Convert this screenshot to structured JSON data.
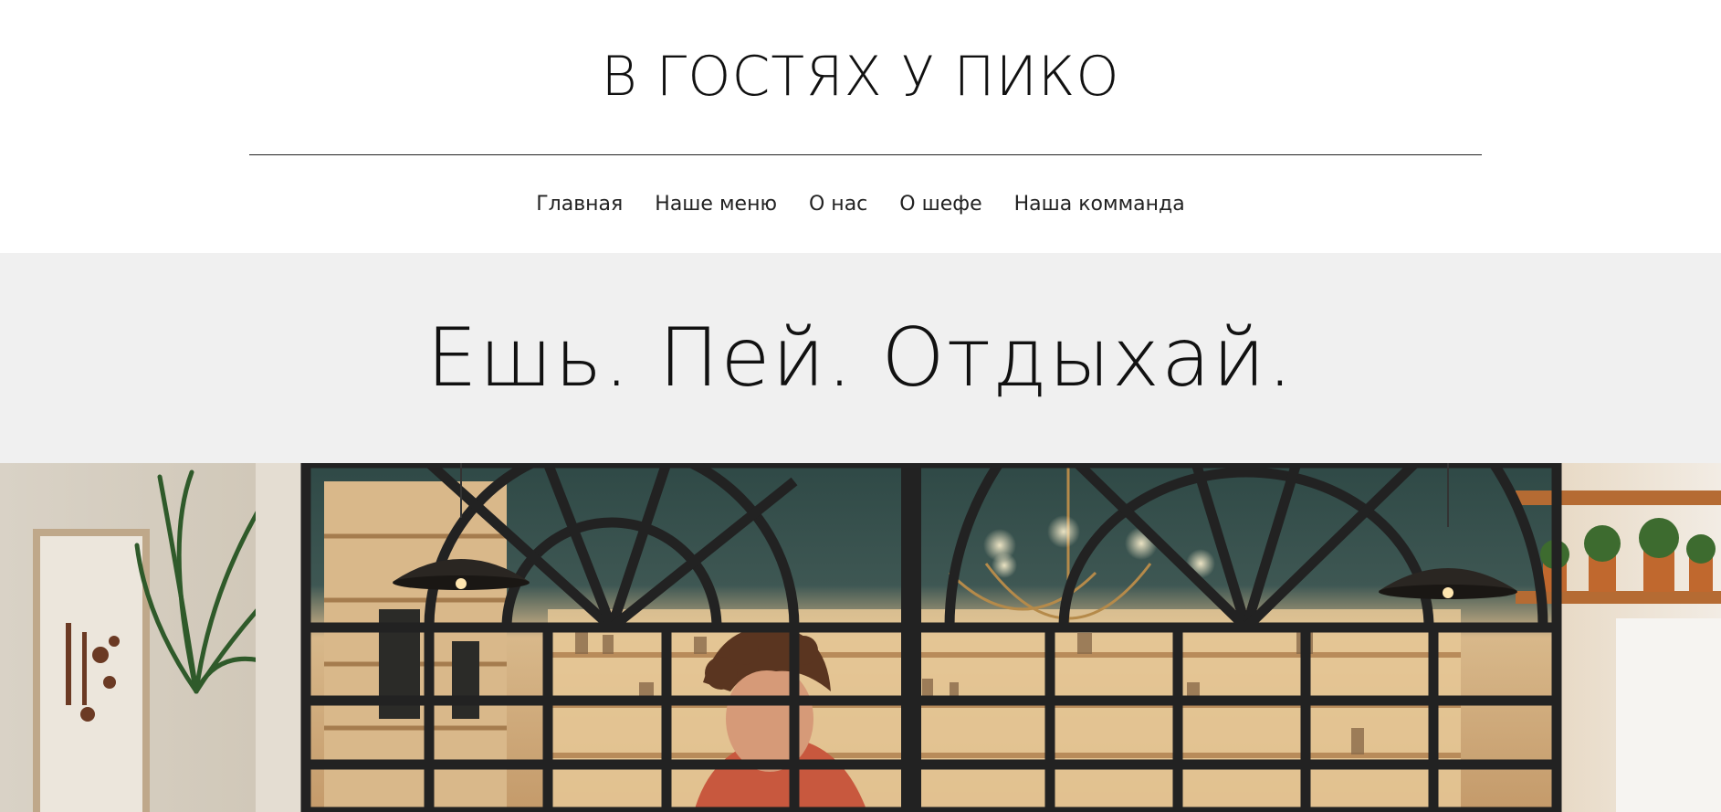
{
  "brand": {
    "title": "В ГОСТЯХ У ПИКО"
  },
  "nav": {
    "items": [
      {
        "label": "Главная"
      },
      {
        "label": "Наше меню"
      },
      {
        "label": "О нас"
      },
      {
        "label": "О шефе"
      },
      {
        "label": "Наша комманда"
      }
    ]
  },
  "hero": {
    "tagline": "Ешь. Пей. Отдыхай."
  },
  "colors": {
    "band_background": "#f0f0f0",
    "text": "#111111",
    "page_background": "#ffffff"
  }
}
